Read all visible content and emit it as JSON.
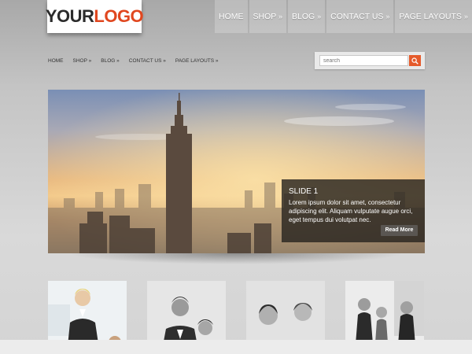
{
  "logo": {
    "part1": "YOUR",
    "part2": "LOGO"
  },
  "top_nav": [
    {
      "label": "HOME",
      "arrow": ""
    },
    {
      "label": "SHOP",
      "arrow": "»"
    },
    {
      "label": "BLOG",
      "arrow": "»"
    },
    {
      "label": "CONTACT US",
      "arrow": "»"
    },
    {
      "label": "PAGE LAYOUTS",
      "arrow": "»"
    }
  ],
  "sub_nav": [
    {
      "label": "HOME",
      "arrow": ""
    },
    {
      "label": "SHOP",
      "arrow": "»"
    },
    {
      "label": "BLOG",
      "arrow": "»"
    },
    {
      "label": "CONTACT US",
      "arrow": "»"
    },
    {
      "label": "PAGE LAYOUTS",
      "arrow": "»"
    }
  ],
  "search": {
    "placeholder": "search",
    "icon": "search-icon"
  },
  "slide": {
    "title": "SLIDE 1",
    "text": "Lorem ipsum dolor sit amet, consectetur adipiscing elit. Aliquam vulputate augue orci, eget tempus dui volutpat nec.",
    "button": "Read More"
  },
  "colors": {
    "accent": "#e55a2b",
    "logo_red": "#e0471f",
    "logo_dark": "#2b2b2b"
  }
}
